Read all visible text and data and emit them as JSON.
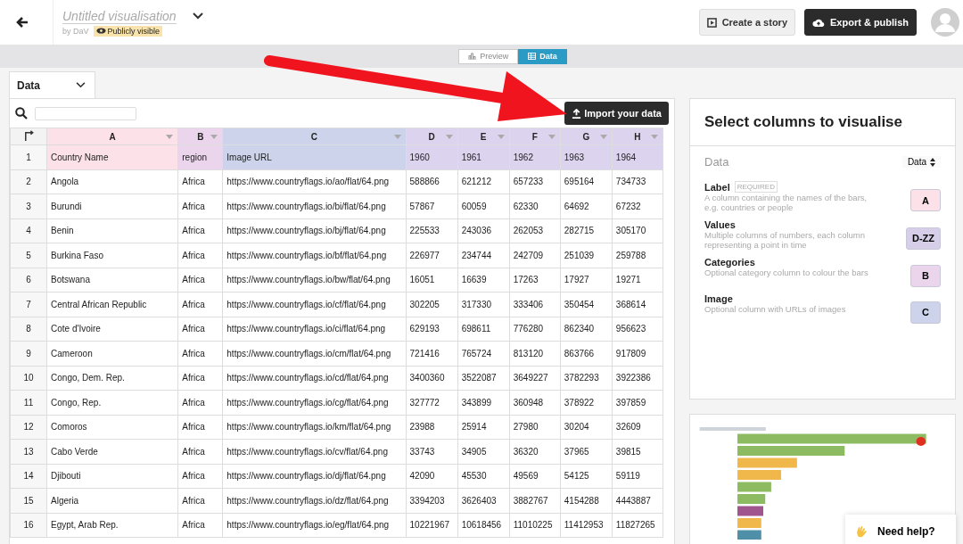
{
  "header": {
    "title": "Untitled visualisation",
    "author": "by DaV",
    "visibility": "Publicly visible",
    "buttons": [
      {
        "label": "Create a story",
        "kind": "secondary"
      },
      {
        "label": "Export & publish",
        "kind": "primary"
      }
    ]
  },
  "view_toggle": [
    {
      "label": "Preview",
      "selected": false
    },
    {
      "label": "Data",
      "selected": true
    }
  ],
  "sheet_tab": {
    "label": "Data"
  },
  "import_button": "Import your data",
  "table": {
    "columns": [
      {
        "letter": "A",
        "color": "#fde1e9"
      },
      {
        "letter": "B",
        "color": "#ebd5ec"
      },
      {
        "letter": "C",
        "color": "#ccd3ea"
      },
      {
        "letter": "D",
        "color": "#dcd3ef"
      },
      {
        "letter": "E",
        "color": "#dcd3ef"
      },
      {
        "letter": "F",
        "color": "#dcd3ef"
      },
      {
        "letter": "G",
        "color": "#dcd3ef"
      },
      {
        "letter": "H",
        "color": "#dcd3ef"
      }
    ],
    "rows": [
      {
        "number": "1",
        "cells": [
          "Country Name",
          "region",
          "Image URL",
          "1960",
          "1961",
          "1962",
          "1963",
          "1964"
        ]
      },
      {
        "number": "2",
        "cells": [
          "Angola",
          "Africa",
          "https://www.countryflags.io/ao/flat/64.png",
          "588866",
          "621212",
          "657233",
          "695164",
          "734733"
        ]
      },
      {
        "number": "3",
        "cells": [
          "Burundi",
          "Africa",
          "https://www.countryflags.io/bi/flat/64.png",
          "57867",
          "60059",
          "62330",
          "64692",
          "67232"
        ]
      },
      {
        "number": "4",
        "cells": [
          "Benin",
          "Africa",
          "https://www.countryflags.io/bj/flat/64.png",
          "225533",
          "243036",
          "262053",
          "282715",
          "305170"
        ]
      },
      {
        "number": "5",
        "cells": [
          "Burkina Faso",
          "Africa",
          "https://www.countryflags.io/bf/flat/64.png",
          "226977",
          "234744",
          "242709",
          "251039",
          "259788"
        ]
      },
      {
        "number": "6",
        "cells": [
          "Botswana",
          "Africa",
          "https://www.countryflags.io/bw/flat/64.png",
          "16051",
          "16639",
          "17263",
          "17927",
          "19271"
        ]
      },
      {
        "number": "7",
        "cells": [
          "Central African Republic",
          "Africa",
          "https://www.countryflags.io/cf/flat/64.png",
          "302205",
          "317330",
          "333406",
          "350454",
          "368614"
        ]
      },
      {
        "number": "8",
        "cells": [
          "Cote d'Ivoire",
          "Africa",
          "https://www.countryflags.io/ci/flat/64.png",
          "629193",
          "698611",
          "776280",
          "862340",
          "956623"
        ]
      },
      {
        "number": "9",
        "cells": [
          "Cameroon",
          "Africa",
          "https://www.countryflags.io/cm/flat/64.png",
          "721416",
          "765724",
          "813120",
          "863766",
          "917809"
        ]
      },
      {
        "number": "10",
        "cells": [
          "Congo, Dem. Rep.",
          "Africa",
          "https://www.countryflags.io/cd/flat/64.png",
          "3400360",
          "3522087",
          "3649227",
          "3782293",
          "3922386"
        ]
      },
      {
        "number": "11",
        "cells": [
          "Congo, Rep.",
          "Africa",
          "https://www.countryflags.io/cg/flat/64.png",
          "327772",
          "343899",
          "360948",
          "378922",
          "397859"
        ]
      },
      {
        "number": "12",
        "cells": [
          "Comoros",
          "Africa",
          "https://www.countryflags.io/km/flat/64.png",
          "23988",
          "25914",
          "27980",
          "30204",
          "32609"
        ]
      },
      {
        "number": "13",
        "cells": [
          "Cabo Verde",
          "Africa",
          "https://www.countryflags.io/cv/flat/64.png",
          "33743",
          "34905",
          "36320",
          "37965",
          "39815"
        ]
      },
      {
        "number": "14",
        "cells": [
          "Djibouti",
          "Africa",
          "https://www.countryflags.io/dj/flat/64.png",
          "42090",
          "45530",
          "49569",
          "54125",
          "59119"
        ]
      },
      {
        "number": "15",
        "cells": [
          "Algeria",
          "Africa",
          "https://www.countryflags.io/dz/flat/64.png",
          "3394203",
          "3626403",
          "3882767",
          "4154288",
          "4443887"
        ]
      },
      {
        "number": "16",
        "cells": [
          "Egypt, Arab Rep.",
          "Africa",
          "https://www.countryflags.io/eg/flat/64.png",
          "10221967",
          "10618456",
          "11010225",
          "11412953",
          "11827265"
        ]
      }
    ]
  },
  "columns_panel": {
    "title": "Select columns to visualise",
    "section": "Data",
    "sheet_select": "Data",
    "bindings": [
      {
        "name": "Label",
        "required": "REQUIRED",
        "description": "A column containing the names of the bars, e.g. countries or people",
        "column": "A",
        "color": "#fde1e9"
      },
      {
        "name": "Values",
        "description": "Multiple columns of numbers, each column representing a point in time",
        "column": "D-ZZ",
        "color": "#d7cfe9"
      },
      {
        "name": "Categories",
        "description": "Optional category column to colour the bars",
        "column": "B",
        "color": "#ebd5ec"
      },
      {
        "name": "Image",
        "description": "Optional column with URLs of images",
        "column": "C",
        "color": "#ccd3ea"
      }
    ]
  },
  "help_button": "Need help?"
}
